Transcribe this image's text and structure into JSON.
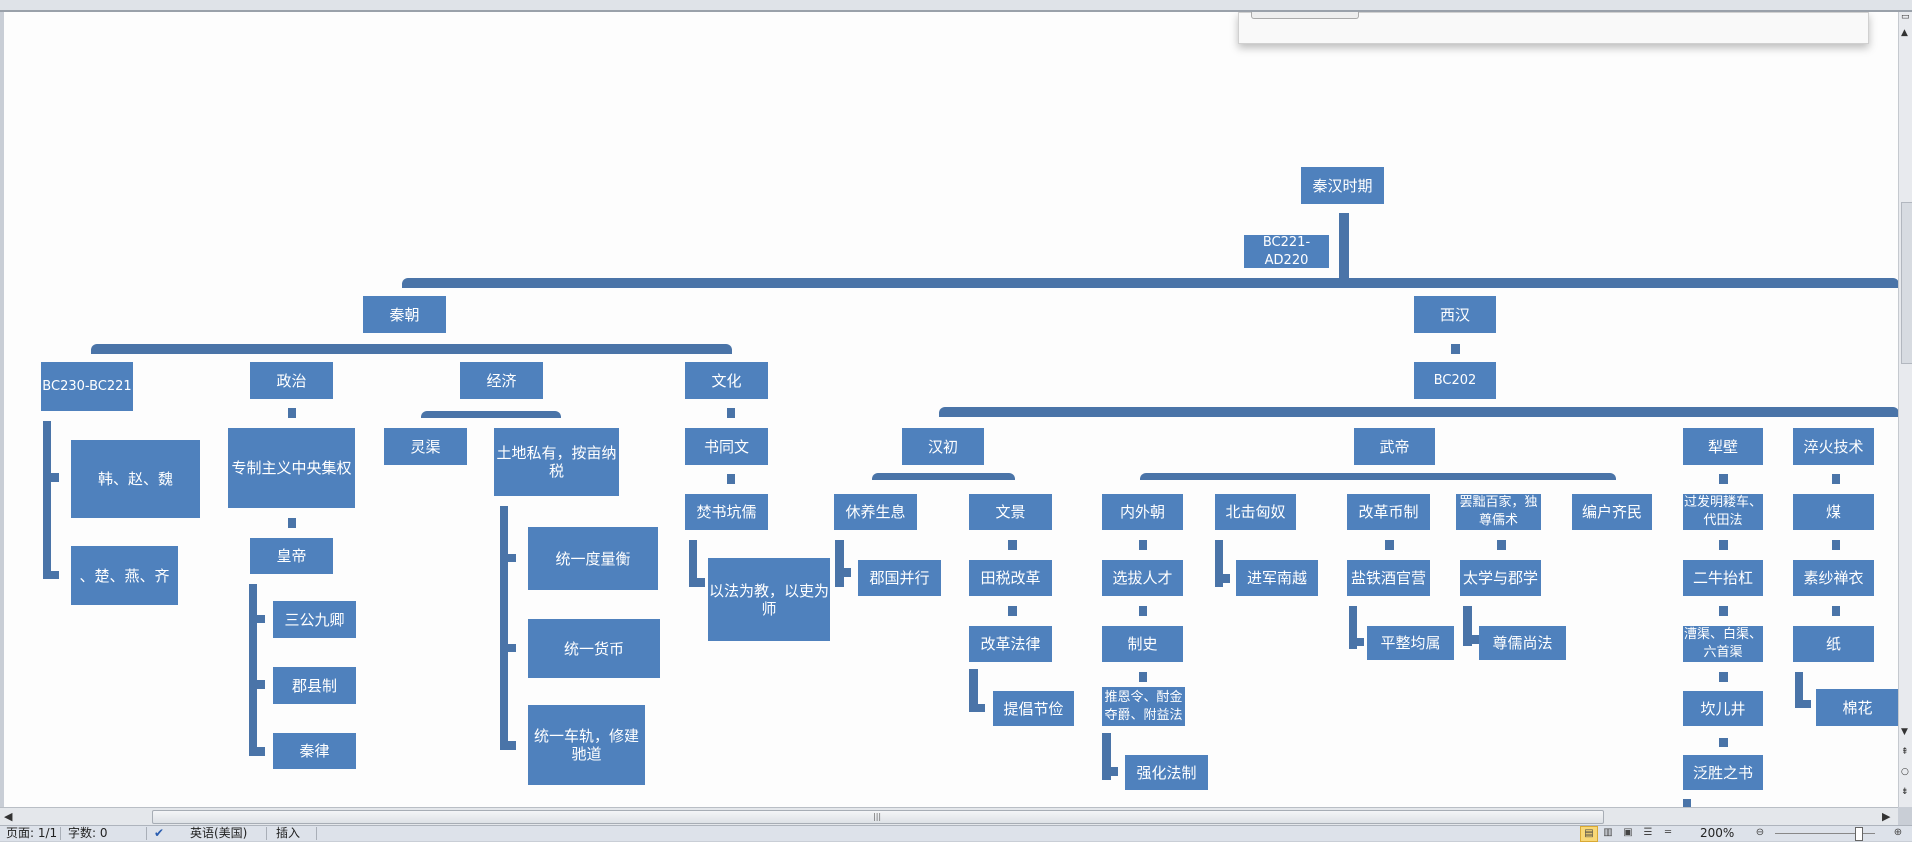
{
  "chart": {
    "root": "秦汉时期",
    "root_period": "BC221-AD220",
    "qin": {
      "title": "秦朝",
      "period": {
        "label": "BC230-BC221",
        "items": [
          "韩、赵、魏",
          "、楚、燕、齐"
        ]
      },
      "politics": {
        "label": "政治",
        "chain": [
          "专制主义中央集权",
          "皇帝"
        ],
        "items": [
          "三公九卿",
          "郡县制",
          "秦律"
        ]
      },
      "economy": {
        "label": "经济",
        "children": [
          "灵渠",
          "土地私有，按亩纳税"
        ],
        "items": [
          "统一度量衡",
          "统一货币",
          "统一车轨，修建驰道"
        ]
      },
      "culture": {
        "label": "文化",
        "chain": [
          "书同文",
          "焚书坑儒"
        ],
        "items": [
          "以法为教，以吏为师"
        ]
      }
    },
    "xihan": {
      "title": "西汉",
      "period": "BC202",
      "hanchu": {
        "label": "汉初",
        "xiuyang": {
          "label": "休养生息",
          "items": [
            "郡国并行"
          ]
        },
        "wenjing": {
          "label": "文景",
          "chain": [
            "田税改革",
            "改革法律"
          ],
          "items": [
            "提倡节俭"
          ]
        }
      },
      "wudi": {
        "label": "武帝",
        "neiwai": {
          "label": "内外朝",
          "chain": [
            "选拔人才",
            "制史",
            "推恩令、酎金夺爵、附益法"
          ],
          "items": [
            "强化法制"
          ]
        },
        "beiji": {
          "label": "北击匈奴",
          "items": [
            "进军南越"
          ]
        },
        "gaige": {
          "label": "改革币制",
          "chain": [
            "盐铁酒官营"
          ],
          "items": [
            "平整均属"
          ]
        },
        "bachu": {
          "label": "罢黜百家，独尊儒术",
          "chain": [
            "太学与郡学"
          ],
          "items": [
            "尊儒尚法"
          ]
        },
        "bianhu": {
          "label": "编户齐民"
        }
      },
      "libi": {
        "label": "犁壁",
        "chain": [
          "过发明耧车、代田法",
          "二牛抬杠",
          "漕渠、白渠、六首渠",
          "坎儿井",
          "泛胜之书"
        ]
      },
      "cuihuo": {
        "label": "淬火技术",
        "chain": [
          "煤",
          "素纱禅衣",
          "纸"
        ],
        "items": [
          "棉花"
        ]
      }
    }
  },
  "status": {
    "page": "页面: 1/1",
    "words": "字数: 0",
    "language": "英语(美国)",
    "mode": "插入",
    "zoom": "200%"
  },
  "colors": {
    "node": "#4f81bd",
    "connector": "#4a74a8"
  }
}
